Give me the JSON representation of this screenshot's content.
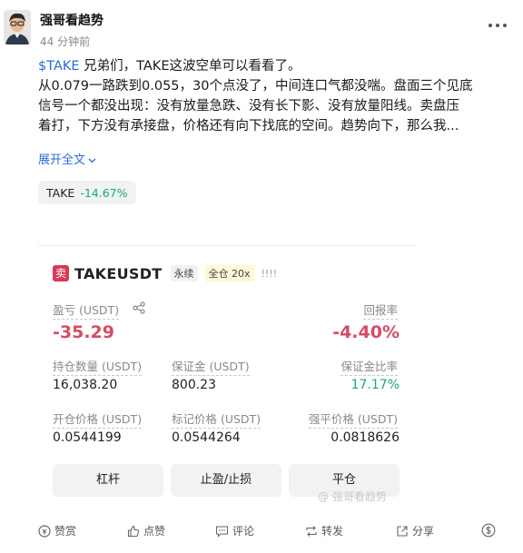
{
  "post": {
    "author": "强哥看趋势",
    "time": "44 分钟前",
    "ticker": "$TAKE",
    "text_line1_rest": " 兄弟们，TAKE这波空单可以看看了。",
    "text_line2": "从0.079一路跌到0.055，30个点没了，中间连口气都没喘。盘面三个见底",
    "text_line3": "信号一个都没出现：没有放量急跌、没有长下影、没有放量阳线。卖盘压",
    "text_line4": "着打，下方没有承接盘，价格还有向下找底的空间。趋势向下，那么我...",
    "expand_label": "展开全文"
  },
  "chip": {
    "symbol": "TAKE",
    "change": "-14.67%"
  },
  "card": {
    "side_badge": "卖",
    "pair": "TAKEUSDT",
    "contract_type": "永续",
    "margin_mode": "全仓 20x",
    "signal_bars": "!!!!",
    "pnl_label": "盈亏 (USDT)",
    "pnl_value": "-35.29",
    "roe_label": "回报率",
    "roe_value": "-4.40%",
    "size_label": "持仓数量 (USDT)",
    "size_value": "16,038.20",
    "margin_label": "保证金 (USDT)",
    "margin_value": "800.23",
    "margin_ratio_label": "保证金比率",
    "margin_ratio_value": "17.17%",
    "entry_label": "开仓价格 (USDT)",
    "entry_value": "0.0544199",
    "mark_label": "标记价格 (USDT)",
    "mark_value": "0.0544264",
    "liq_label": "强平价格 (USDT)",
    "liq_value": "0.0818626",
    "btn_leverage": "杠杆",
    "btn_tpsl": "止盈/止损",
    "btn_close": "平仓",
    "watermark": "@ 强哥看趋势"
  },
  "footer": {
    "tip": "赞赏",
    "like": "点赞",
    "comment": "评论",
    "repost": "转发",
    "share": "分享"
  },
  "colors": {
    "link": "#2a6bd6",
    "negative": "#d64b65",
    "positive": "#19a974"
  }
}
